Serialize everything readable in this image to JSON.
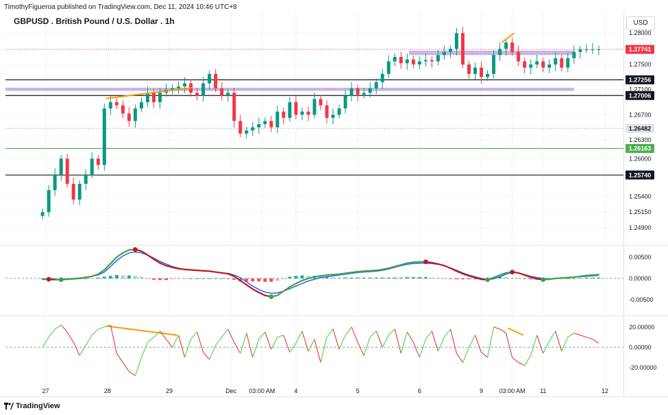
{
  "header": {
    "publisher": "TimothyFigueroa published on TradingView.com, Dec 11, 2024 10:46 UTC+8",
    "symbol": "GBPUSD . British Pound / U.S. Dollar . 1h",
    "currency": "USD"
  },
  "footer": {
    "brand": "TradingView"
  },
  "colors": {
    "bull": "#089981",
    "bear": "#f23645",
    "zone": "#b39ddb",
    "trend": "#ff9800",
    "macd": "#2962ff",
    "signal_up": "#43a047",
    "signal_down": "#b71c1c",
    "osc_up": "#43d73a",
    "osc_down": "#e53935",
    "support": "#4caf50"
  },
  "chart_data": [
    {
      "type": "candlestick",
      "title": "GBPUSD . British Pound / U.S. Dollar . 1h",
      "x_ticks": [
        "27",
        "28",
        "29",
        "Dec",
        "03:00 AM",
        "4",
        "5",
        "6",
        "9",
        "03:00 AM",
        "11",
        "12"
      ],
      "x_tick_pos": [
        0.5,
        10.5,
        20.5,
        30.5,
        35.5,
        41,
        51,
        61,
        71,
        76,
        81,
        91
      ],
      "x_range": [
        -6,
        94
      ],
      "ylim": [
        1.2465,
        1.2833
      ],
      "y_ticks": [
        "1.28000",
        "1.27500",
        "1.27100",
        "1.26700",
        "1.26300",
        "1.26000",
        "1.25400",
        "1.25150",
        "1.24900"
      ],
      "y_tick_values": [
        1.28,
        1.275,
        1.271,
        1.267,
        1.263,
        1.26,
        1.254,
        1.2515,
        1.249
      ],
      "price_labels": [
        {
          "value": 1.27741,
          "text": "1.27741",
          "style": "last"
        },
        {
          "value": 1.27256,
          "text": "1.27256",
          "style": "black"
        },
        {
          "value": 1.27006,
          "text": "1.27006",
          "style": "black"
        },
        {
          "value": 1.26482,
          "text": "1.26482",
          "style": "grey"
        },
        {
          "value": 1.26163,
          "text": "1.26163",
          "style": "green"
        },
        {
          "value": 1.2574,
          "text": "1.25740",
          "style": "black"
        }
      ],
      "horizontal_lines": [
        {
          "value": 1.27256,
          "style": "black"
        },
        {
          "value": 1.27006,
          "style": "black"
        },
        {
          "value": 1.26163,
          "style": "green"
        },
        {
          "value": 1.2574,
          "style": "black"
        },
        {
          "value": 1.26482,
          "style": "grey"
        },
        {
          "value": 1.27741,
          "style": "last"
        }
      ],
      "zones": [
        {
          "from": 1.2765,
          "to": 1.2772,
          "x0": 59.3,
          "x1": 86
        },
        {
          "from": 1.2708,
          "to": 1.2713,
          "x0": -6,
          "x1": 86
        }
      ],
      "trendlines": [
        {
          "x0": 10.3,
          "y0": 1.2696,
          "x1": 24.3,
          "y1": 1.2713
        },
        {
          "x0": 74.3,
          "y0": 1.2785,
          "x1": 76.3,
          "y1": 1.28
        }
      ],
      "closes": [
        1.2515,
        1.255,
        1.2575,
        1.26,
        1.256,
        1.2535,
        1.256,
        1.2575,
        1.26,
        1.259,
        1.268,
        1.269,
        1.2685,
        1.2672,
        1.266,
        1.268,
        1.269,
        1.2705,
        1.269,
        1.2705,
        1.271,
        1.2712,
        1.2715,
        1.272,
        1.2705,
        1.27,
        1.272,
        1.2735,
        1.2712,
        1.27,
        1.2705,
        1.266,
        1.264,
        1.2645,
        1.265,
        1.2655,
        1.266,
        1.265,
        1.2675,
        1.2665,
        1.269,
        1.267,
        1.2675,
        1.267,
        1.2695,
        1.2685,
        1.2665,
        1.267,
        1.268,
        1.27,
        1.2712,
        1.2702,
        1.2705,
        1.2712,
        1.2722,
        1.2735,
        1.2755,
        1.2762,
        1.2752,
        1.2758,
        1.275,
        1.2755,
        1.2757,
        1.2755,
        1.2765,
        1.277,
        1.2775,
        1.28,
        1.275,
        1.2735,
        1.2745,
        1.273,
        1.2735,
        1.2765,
        1.2775,
        1.2785,
        1.277,
        1.2755,
        1.2745,
        1.275,
        1.2755,
        1.2745,
        1.275,
        1.276,
        1.2745,
        1.276,
        1.277,
        1.2774,
        1.2774,
        1.2774,
        1.2774
      ],
      "series_count": 91
    },
    {
      "type": "line",
      "title": "",
      "ylim": [
        -0.0084,
        0.0074
      ],
      "y_ticks": [
        "0.00500",
        "0.00000",
        "-0.00500"
      ],
      "y_tick_values": [
        0.005,
        0.0,
        -0.005
      ],
      "series": [
        {
          "name": "",
          "color": "#2962ff",
          "values": [
            -0.0001,
            -0.0001,
            -0.0002,
            -0.0002,
            -0.0001,
            0.0,
            0.0001,
            0.0003,
            0.0005,
            0.0008,
            0.0015,
            0.0028,
            0.0042,
            0.0053,
            0.006,
            0.0062,
            0.006,
            0.0055,
            0.0048,
            0.004,
            0.0034,
            0.0028,
            0.0024,
            0.0021,
            0.002,
            0.0019,
            0.0018,
            0.0017,
            0.0015,
            0.0013,
            0.0012,
            0.0008,
            0.0002,
            -0.0008,
            -0.0018,
            -0.0026,
            -0.0032,
            -0.0035,
            -0.0034,
            -0.003,
            -0.0024,
            -0.0018,
            -0.0012,
            -0.0006,
            -0.0002,
            0.0002,
            0.0004,
            0.0006,
            0.0008,
            0.001,
            0.0012,
            0.0014,
            0.0015,
            0.0016,
            0.0017,
            0.0019,
            0.0022,
            0.0026,
            0.003,
            0.0033,
            0.0035,
            0.0036,
            0.0036,
            0.0035,
            0.0033,
            0.003,
            0.0025,
            0.0019,
            0.0013,
            0.0008,
            0.0004,
            0.0,
            -0.0003,
            -0.0001,
            0.0004,
            0.001,
            0.0014,
            0.0013,
            0.0009,
            0.0005,
            0.0002,
            0.0,
            -0.0001,
            0.0,
            0.0001,
            0.0002,
            0.0003,
            0.0004,
            0.0005,
            0.0006,
            0.0007
          ]
        },
        {
          "name": "",
          "color": "#43a047",
          "values": [
            -0.0002,
            -0.0002,
            -0.0003,
            -0.0003,
            -0.0002,
            -0.0001,
            0.0,
            0.0002,
            0.0005,
            0.001,
            0.002,
            0.0035,
            0.005,
            0.006,
            0.0067,
            0.0068,
            0.0064,
            0.0055,
            0.0045,
            0.0036,
            0.003,
            0.0026,
            0.0023,
            0.0021,
            0.002,
            0.0019,
            0.0018,
            0.0017,
            0.0015,
            0.0013,
            0.0011,
            0.0005,
            -0.0005,
            -0.0015,
            -0.0025,
            -0.0033,
            -0.004,
            -0.0043,
            -0.004,
            -0.003,
            -0.002,
            -0.0012,
            -0.0005,
            0.0,
            0.0004,
            0.0006,
            0.0008,
            0.0009,
            0.001,
            0.0012,
            0.0014,
            0.0016,
            0.0017,
            0.0018,
            0.0019,
            0.0021,
            0.0024,
            0.0028,
            0.0032,
            0.0036,
            0.0038,
            0.0039,
            0.0039,
            0.0037,
            0.0034,
            0.003,
            0.0024,
            0.0017,
            0.0011,
            0.0006,
            0.0002,
            -0.0002,
            -0.0003,
            0.0002,
            0.0008,
            0.0013,
            0.0015,
            0.0013,
            0.0008,
            0.0003,
            -0.0001,
            -0.0003,
            -0.0002,
            0.0,
            0.0001,
            0.0002,
            0.0003,
            0.0005,
            0.0007,
            0.0008,
            0.0009
          ]
        }
      ],
      "histogram": [
        0,
        0,
        -0.0001,
        -0.0001,
        -0.0001,
        -0.0001,
        -0.0001,
        -0.0001,
        0.0,
        0.0002,
        0.0004,
        0.0006,
        0.0008,
        0.0007,
        0.0007,
        0.0006,
        0.0004,
        0.0,
        -0.0003,
        -0.0004,
        -0.0004,
        -0.0002,
        -0.0001,
        0.0,
        0.0,
        0.0,
        0.0,
        0.0,
        0.0,
        0.0,
        -0.0001,
        -0.0003,
        -0.0007,
        -0.0007,
        -0.0007,
        -0.0007,
        -0.0008,
        -0.0008,
        -0.0006,
        0.0,
        0.0004,
        0.0006,
        0.0007,
        0.0006,
        0.0006,
        0.0004,
        0.0004,
        0.0003,
        0.0002,
        0.0002,
        0.0002,
        0.0002,
        0.0002,
        0.0002,
        0.0002,
        0.0002,
        0.0002,
        0.0002,
        0.0002,
        0.0003,
        0.0003,
        0.0003,
        0.0003,
        0.0002,
        0.0001,
        0.0,
        -0.0001,
        -0.0002,
        -0.0002,
        -0.0002,
        -0.0002,
        -0.0002,
        0.0,
        0.0003,
        0.0004,
        0.0003,
        0.0001,
        0.0,
        -0.0001,
        -0.0002,
        -0.0003,
        -0.0002,
        -0.0002,
        0.0,
        0.0,
        0.0,
        0.0,
        0.0001,
        0.0002,
        0.0002,
        0.0002
      ]
    },
    {
      "type": "line",
      "title": "",
      "ylim": [
        -33,
        30
      ],
      "y_ticks": [
        "20.00000",
        "0.00000",
        "-20.00000"
      ],
      "y_tick_values": [
        20,
        0,
        -20
      ],
      "trendlines": [
        {
          "x0": 10.3,
          "y0": 21,
          "x1": 21.8,
          "y1": 12
        },
        {
          "x0": 75.3,
          "y0": 19,
          "x1": 77.8,
          "y1": 12
        }
      ],
      "series": [
        {
          "name": "",
          "values": [
            0,
            10,
            18,
            22,
            15,
            5,
            -8,
            2,
            12,
            18,
            20,
            22,
            -6,
            -15,
            -24,
            -28,
            -10,
            5,
            10,
            16,
            8,
            0,
            12,
            -10,
            8,
            15,
            -5,
            -12,
            2,
            10,
            18,
            5,
            -6,
            14,
            -10,
            8,
            15,
            -2,
            10,
            12,
            -5,
            4,
            16,
            -4,
            8,
            -15,
            10,
            18,
            -2,
            12,
            20,
            5,
            -8,
            10,
            16,
            0,
            12,
            18,
            -6,
            15,
            5,
            -10,
            8,
            16,
            -4,
            10,
            18,
            -6,
            -15,
            0,
            12,
            -5,
            -10,
            20,
            18,
            14,
            -10,
            -15,
            -18,
            -8,
            12,
            -6,
            6,
            16,
            -4,
            10,
            14,
            12,
            10,
            8,
            4
          ]
        }
      ]
    }
  ]
}
